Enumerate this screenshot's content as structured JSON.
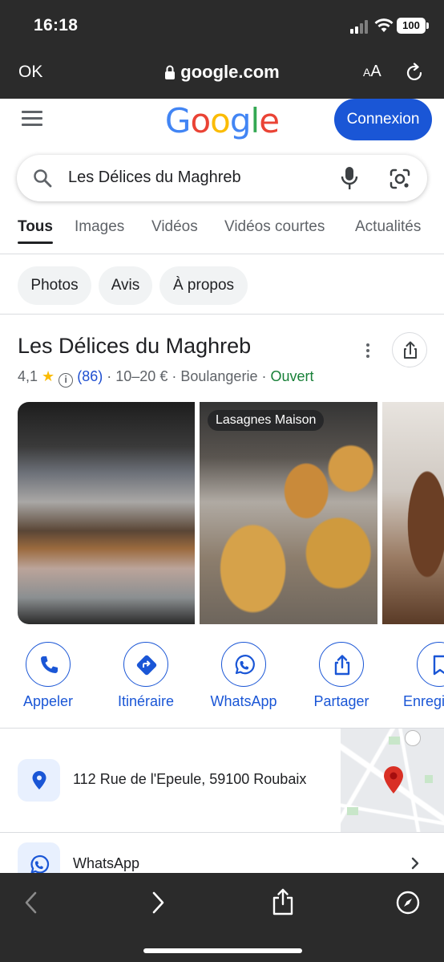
{
  "status_bar": {
    "time": "16:18",
    "battery": "100"
  },
  "browser": {
    "done_label": "OK",
    "domain": "google.com",
    "text_size_label": "AA"
  },
  "header": {
    "logo": [
      {
        "char": "G",
        "color": "#4285F4"
      },
      {
        "char": "o",
        "color": "#EA4335"
      },
      {
        "char": "o",
        "color": "#FBBC05"
      },
      {
        "char": "g",
        "color": "#4285F4"
      },
      {
        "char": "l",
        "color": "#34A853"
      },
      {
        "char": "e",
        "color": "#EA4335"
      }
    ],
    "signin_label": "Connexion"
  },
  "search": {
    "query": "Les Délices du Maghreb"
  },
  "tabs": [
    {
      "label": "Tous",
      "active": true
    },
    {
      "label": "Images",
      "active": false
    },
    {
      "label": "Vidéos",
      "active": false
    },
    {
      "label": "Vidéos courtes",
      "active": false
    },
    {
      "label": "Actualités",
      "active": false
    }
  ],
  "chips": [
    {
      "label": "Photos"
    },
    {
      "label": "Avis"
    },
    {
      "label": "À propos"
    }
  ],
  "business": {
    "name": "Les Délices du Maghreb",
    "rating": "4,1",
    "reviews": "(86)",
    "price": "10–20 €",
    "category": "Boulangerie",
    "status": "Ouvert",
    "photo_caption": "Lasagnes Maison",
    "actions": [
      {
        "label": "Appeler",
        "icon": "phone-icon"
      },
      {
        "label": "Itinéraire",
        "icon": "directions-icon"
      },
      {
        "label": "WhatsApp",
        "icon": "whatsapp-icon"
      },
      {
        "label": "Partager",
        "icon": "share-icon"
      },
      {
        "label": "Enregi",
        "icon": "bookmark-icon"
      }
    ],
    "address": "112 Rue de l'Epeule, 59100 Roubaix",
    "whatsapp_label": "WhatsApp"
  },
  "colors": {
    "accent": "#1A56D6",
    "open": "#188038",
    "star": "#FBBC04",
    "bar": "#2B2B2B"
  }
}
